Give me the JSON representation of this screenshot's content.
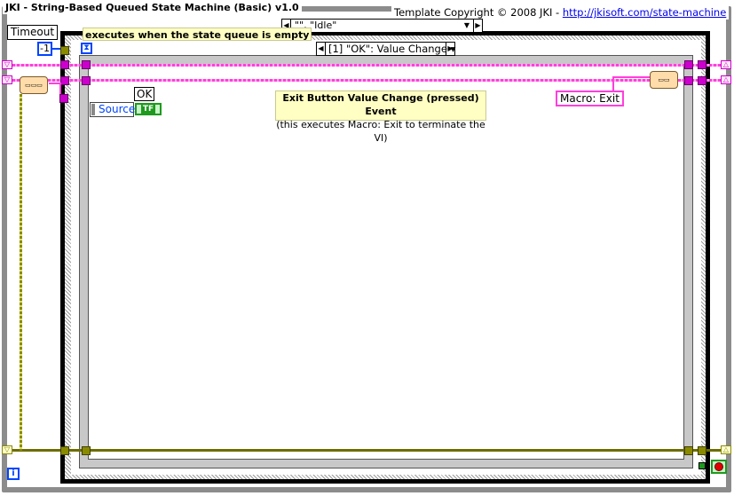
{
  "window": {
    "title": "JKI - String-Based Queued State Machine (Basic) v1.0",
    "copyright_prefix": "Template Copyright © 2008 JKI - ",
    "copyright_link": "http://jkisoft.com/state-machine"
  },
  "case_structure": {
    "selector_value": "\"\", \"Idle\""
  },
  "event_structure": {
    "timeout_comment": "executes when the state queue is empty",
    "selector_value": "[1] \"OK\": Value Change"
  },
  "timeout": {
    "label": "Timeout",
    "value": "-1"
  },
  "event_data": {
    "control_label": "OK",
    "source_label": "Source",
    "boolean_text": "TF"
  },
  "comment": {
    "title": "Exit Button Value Change (pressed) Event",
    "body": "(this executes Macro: Exit to terminate the VI)"
  },
  "macro": {
    "value": "Macro: Exit"
  },
  "loop": {
    "iteration_symbol": "i"
  },
  "icons": {
    "hourglass": "hourglass-icon",
    "stop": "stop-icon",
    "iteration": "loop-iteration-icon"
  },
  "colors": {
    "string_wire": "#ff3fdc",
    "cluster_wire": "#6d6d00",
    "numeric": "#0044ff",
    "boolean": "#1e9a1e",
    "comment_bg": "#ffffc4"
  }
}
